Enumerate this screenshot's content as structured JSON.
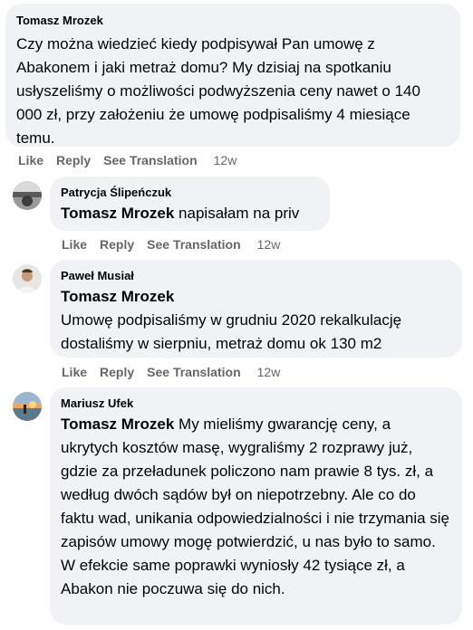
{
  "comments": [
    {
      "author": "Tomasz Mrozek",
      "text": "Czy można wiedzieć kiedy podpisywał Pan umowę z Abakonem i jaki metraż domu? My dzisiaj na spotkaniu usłyszeliśmy o możliwości podwyższenia ceny nawet o 140 000 zł, przy założeniu że umowę podpisaliśmy 4 miesiące temu.",
      "actions": {
        "like": "Like",
        "reply": "Reply",
        "translate": "See Translation",
        "time": "12w"
      }
    },
    {
      "author": "Patrycja Ślipeńczuk",
      "mention": "Tomasz Mrozek",
      "text": " napisałam na priv",
      "actions": {
        "like": "Like",
        "reply": "Reply",
        "translate": "See Translation",
        "time": "12w"
      }
    },
    {
      "author": "Paweł Musiał",
      "mention": "Tomasz Mrozek",
      "text": "Umowę podpisaliśmy w grudniu 2020 rekalkulację dostaliśmy w sierpniu, metraż domu ok 130 m2",
      "actions": {
        "like": "Like",
        "reply": "Reply",
        "translate": "See Translation",
        "time": "12w"
      }
    },
    {
      "author": "Mariusz Ufek",
      "mention": "Tomasz Mrozek",
      "text": " My mieliśmy gwarancję ceny, a ukrytych kosztów masę, wygraliśmy 2 rozprawy już, gdzie za przeładunek policzono nam prawie 8 tys. zł, a według dwóch sądów był on niepotrzebny. Ale co do faktu wad, unikania odpowiedzialności i nie trzymania się zapisów umowy mogę potwierdzić, u nas było to samo. W efekcie same poprawki wyniosły 42 tysiące zł, a Abakon nie poczuwa się do nich."
    }
  ]
}
